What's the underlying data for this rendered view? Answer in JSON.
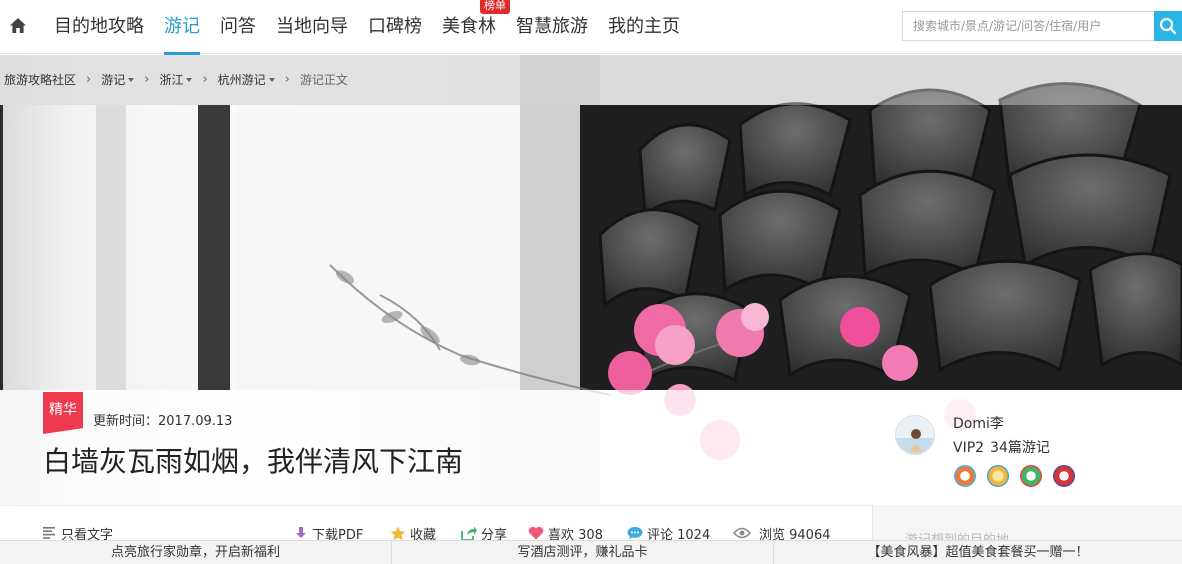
{
  "nav": {
    "items": [
      {
        "label": "目的地攻略",
        "active": false
      },
      {
        "label": "游记",
        "active": true
      },
      {
        "label": "问答",
        "active": false
      },
      {
        "label": "当地向导",
        "active": false
      },
      {
        "label": "口碑榜",
        "active": false
      },
      {
        "label": "美食林",
        "active": false,
        "badge": "榜单"
      },
      {
        "label": "智慧旅游",
        "active": false
      },
      {
        "label": "我的主页",
        "active": false
      }
    ],
    "search_placeholder": "搜索城市/景点/游记/问答/住宿/用户"
  },
  "breadcrumb": {
    "items": [
      "旅游攻略社区",
      "游记",
      "浙江",
      "杭州游记",
      "游记正文"
    ]
  },
  "article": {
    "tag": "精华",
    "updated": "更新时间：2017.09.13",
    "title": "白墙灰瓦雨如烟，我伴清风下江南"
  },
  "author": {
    "name": "Domi李",
    "level": "VIP2",
    "travelogues": "34篇游记",
    "medals": [
      "medal-icon",
      "medal-icon",
      "medal-icon",
      "medal-icon"
    ]
  },
  "actions": {
    "text_only": "只看文字",
    "download": "下载PDF",
    "collect": "收藏",
    "share": "分享",
    "like": "喜欢 308",
    "comment": "评论 1024",
    "views": "浏览 94064"
  },
  "side_hint": "游记想到的目的地",
  "promo": [
    "点亮旅行家勋章，开启新福利",
    "写酒店测评，赚礼品卡",
    "【美食风暴】超值美食套餐买一赠一！"
  ],
  "colors": {
    "accent": "#2a9ed0",
    "ribbon": "#ee3a4e",
    "badge": "#e02a2a",
    "search_button": "#2ab5e8"
  }
}
